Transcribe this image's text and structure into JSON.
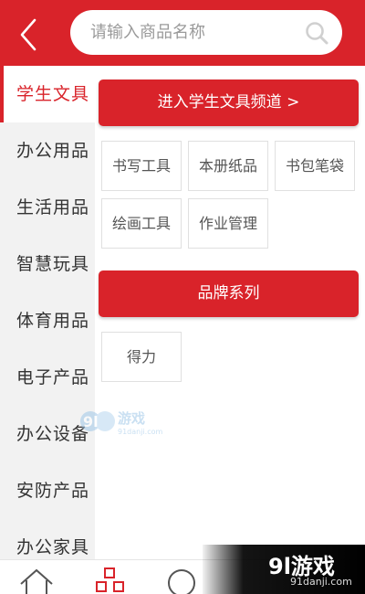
{
  "header": {
    "search_placeholder": "请输入商品名称",
    "accent_color": "#d9232a"
  },
  "sidebar": {
    "items": [
      {
        "label": "学生文具",
        "active": true
      },
      {
        "label": "办公用品",
        "active": false
      },
      {
        "label": "生活用品",
        "active": false
      },
      {
        "label": "智慧玩具",
        "active": false
      },
      {
        "label": "体育用品",
        "active": false
      },
      {
        "label": "电子产品",
        "active": false
      },
      {
        "label": "办公设备",
        "active": false
      },
      {
        "label": "安防产品",
        "active": false
      },
      {
        "label": "办公家具",
        "active": false
      }
    ]
  },
  "panel": {
    "channel_button": "进入学生文具频道 >",
    "subcategories": [
      "书写工具",
      "本册纸品",
      "书包笔袋",
      "绘画工具",
      "作业管理"
    ],
    "brand_header": "品牌系列",
    "brands": [
      "得力"
    ]
  },
  "tabbar": {
    "icons": [
      "home-icon",
      "category-icon",
      "search-circle-icon"
    ]
  },
  "watermark": {
    "logo": "9l游戏",
    "url": "91danji.com"
  }
}
